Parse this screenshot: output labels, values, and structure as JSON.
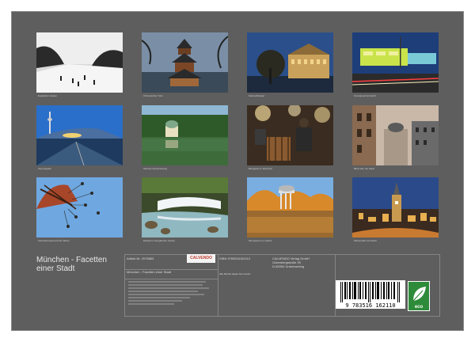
{
  "calendar": {
    "title_line1": "München - Facetten",
    "title_line2": "einer Stadt",
    "brand": "CALVENDO",
    "isbn": "ISBN 9783516162110",
    "subtitle_box": "München - Facetten einer Stadt",
    "publisher_line1": "CALVENDO Verlag GmbH",
    "publisher_line2": "Gutenbergstraße 39",
    "publisher_line3": "D-82054 Unterhaching",
    "barcode_digits": "9 783516 162110",
    "eco_label": "eco",
    "article_no": "Artikel-Nr. 2078863",
    "rights_text": "Alle Rechte liegen beim Autor"
  },
  "photos": [
    {
      "caption": "Englischer Garten"
    },
    {
      "caption": "Chinesischer Turm"
    },
    {
      "caption": "Nationaltheater"
    },
    {
      "caption": "Kunstareal bei Nacht"
    },
    {
      "caption": "Olympiapark"
    },
    {
      "caption": "Schloss Nymphenburg"
    },
    {
      "caption": "Biergarten in München"
    },
    {
      "caption": "Blick über die Stadt"
    },
    {
      "caption": "Kettenkarussell auf der Wiesn"
    },
    {
      "caption": "Eisbach im Englischen Garten"
    },
    {
      "caption": "Monopteros im Herbst"
    },
    {
      "caption": "Marienplatz bei Nacht"
    }
  ]
}
